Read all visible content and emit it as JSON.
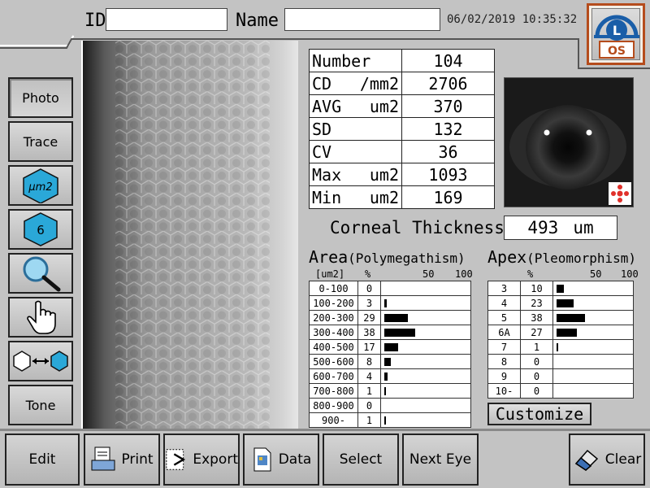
{
  "header": {
    "id_label": "ID",
    "id_value": "",
    "name_label": "Name",
    "name_value": "",
    "timestamp": "06/02/2019 10:35:32",
    "eye_badge": {
      "letter": "L",
      "label": "OS",
      "accent": "#1a5ea8",
      "border": "#b54c1c"
    }
  },
  "sidebar": {
    "items": [
      {
        "label": "Photo",
        "icon": null,
        "active": true
      },
      {
        "label": "Trace",
        "icon": null,
        "active": false
      },
      {
        "label": "μm2",
        "icon": "hexagon-area-icon",
        "active": false
      },
      {
        "label": "6",
        "icon": "hexagon-apex-icon",
        "active": false
      },
      {
        "label": "",
        "icon": "magnifier-icon",
        "active": false
      },
      {
        "label": "",
        "icon": "hand-pointer-icon",
        "active": false
      },
      {
        "label": "",
        "icon": "hexagon-swap-icon",
        "active": false
      },
      {
        "label": "Tone",
        "icon": null,
        "active": false
      }
    ]
  },
  "stats": [
    {
      "label": "Number",
      "unit": "",
      "value": "104"
    },
    {
      "label": "CD",
      "unit": "/mm2",
      "value": "2706"
    },
    {
      "label": "AVG",
      "unit": "um2",
      "value": "370"
    },
    {
      "label": "SD",
      "unit": "",
      "value": "132"
    },
    {
      "label": "CV",
      "unit": "",
      "value": "36"
    },
    {
      "label": "Max",
      "unit": "um2",
      "value": "1093"
    },
    {
      "label": "Min",
      "unit": "um2",
      "value": "169"
    }
  ],
  "corneal_thickness": {
    "label": "Corneal Thickness",
    "value": "493",
    "unit": "um"
  },
  "area": {
    "title": "Area",
    "subtitle": "(Polymegathism)",
    "unit_header": "[um2]",
    "pct_header": "%",
    "scale": [
      "50",
      "100"
    ],
    "rows": [
      {
        "range": "0-100",
        "pct": 0
      },
      {
        "range": "100-200",
        "pct": 3
      },
      {
        "range": "200-300",
        "pct": 29
      },
      {
        "range": "300-400",
        "pct": 38
      },
      {
        "range": "400-500",
        "pct": 17
      },
      {
        "range": "500-600",
        "pct": 8
      },
      {
        "range": "600-700",
        "pct": 4
      },
      {
        "range": "700-800",
        "pct": 1
      },
      {
        "range": "800-900",
        "pct": 0
      },
      {
        "range": "900-",
        "pct": 1
      }
    ]
  },
  "apex": {
    "title": "Apex",
    "subtitle": "(Pleomorphism)",
    "pct_header": "%",
    "scale": [
      "50",
      "100"
    ],
    "rows": [
      {
        "apex": "3",
        "pct": 10
      },
      {
        "apex": "4",
        "pct": 23
      },
      {
        "apex": "5",
        "pct": 38
      },
      {
        "apex": "6A",
        "pct": 27
      },
      {
        "apex": "7",
        "pct": 1
      },
      {
        "apex": "8",
        "pct": 0
      },
      {
        "apex": "9",
        "pct": 0
      },
      {
        "apex": "10-",
        "pct": 0
      }
    ]
  },
  "customize_label": "Customize",
  "bottom_bar": [
    {
      "label": "Edit",
      "icon": null
    },
    {
      "label": "Print",
      "icon": "printer-icon"
    },
    {
      "label": "Export",
      "icon": "export-icon"
    },
    {
      "label": "Data",
      "icon": "data-icon"
    },
    {
      "label": "Select",
      "icon": null
    },
    {
      "label": "Next Eye",
      "icon": null
    },
    {
      "label": "Clear",
      "icon": "eraser-icon"
    }
  ]
}
